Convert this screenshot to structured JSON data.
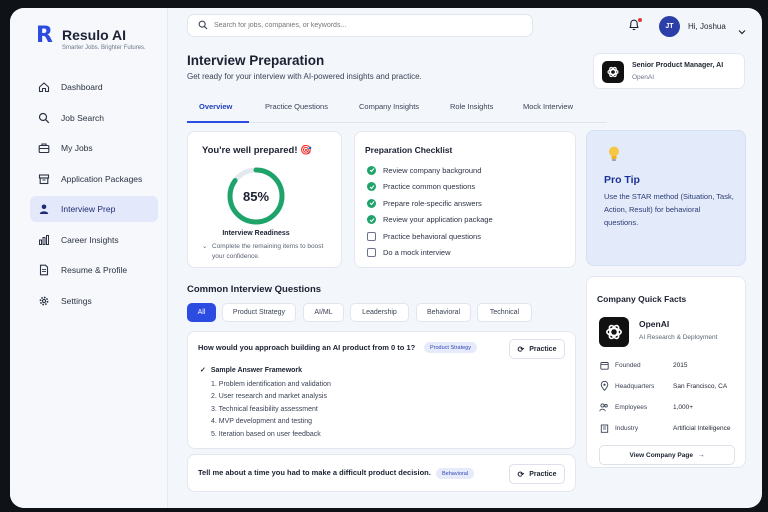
{
  "brand": {
    "name": "Resulo AI",
    "tagline": "Smarter Jobs. Brighter Futures.",
    "accent": "#2c4be0"
  },
  "sidebar": {
    "items": [
      {
        "label": "Dashboard",
        "icon": "home-icon"
      },
      {
        "label": "Job Search",
        "icon": "search-icon"
      },
      {
        "label": "My Jobs",
        "icon": "briefcase-icon"
      },
      {
        "label": "Application Packages",
        "icon": "package-icon"
      },
      {
        "label": "Interview Prep",
        "icon": "user-icon",
        "active": true
      },
      {
        "label": "Career Insights",
        "icon": "bar-chart-icon"
      },
      {
        "label": "Resume & Profile",
        "icon": "document-icon"
      },
      {
        "label": "Settings",
        "icon": "gear-icon"
      }
    ]
  },
  "header": {
    "search_placeholder": "Search for jobs, companies, or keywords...",
    "avatar_initials": "JT",
    "user_greeting": "Hi, Joshua"
  },
  "page": {
    "title": "Interview Preparation",
    "subtitle": "Get ready for your interview with AI-powered insights and practice.",
    "role": {
      "title": "Senior Product Manager, AI",
      "company": "OpenAI"
    }
  },
  "tabs": [
    "Overview",
    "Practice Questions",
    "Company Insights",
    "Role Insights",
    "Mock Interview"
  ],
  "readiness": {
    "heading": "You're well prepared! 🎯",
    "percent_label": "85%",
    "percent": 85,
    "label": "Interview Readiness",
    "note": "Complete the remaining items to boost your confidence.",
    "ring_color": "#1ea36a"
  },
  "checklist": {
    "title": "Preparation Checklist",
    "items": [
      {
        "label": "Review company background",
        "done": true
      },
      {
        "label": "Practice common questions",
        "done": true
      },
      {
        "label": "Prepare role-specific answers",
        "done": true
      },
      {
        "label": "Review your application package",
        "done": true
      },
      {
        "label": "Practice behavioral questions",
        "done": false
      },
      {
        "label": "Do a mock interview",
        "done": false
      }
    ]
  },
  "tip": {
    "title": "Pro Tip",
    "body": "Use the STAR method (Situation, Task, Action, Result) for behavioral questions."
  },
  "questions": {
    "title": "Common Interview Questions",
    "filters": [
      "All",
      "Product Strategy",
      "AI/ML",
      "Leadership",
      "Behavioral",
      "Technical"
    ],
    "practice_label": "Practice",
    "items": [
      {
        "text": "How would you approach building an AI product from 0 to 1?",
        "tag": "Product Strategy",
        "answer_heading": "Sample Answer Framework",
        "steps": [
          "1. Problem identification and validation",
          "2. User research and market analysis",
          "3. Technical feasibility assessment",
          "4. MVP development and testing",
          "5. Iteration based on user feedback"
        ]
      },
      {
        "text": "Tell me about a time you had to make a difficult product decision.",
        "tag": "Behavioral"
      }
    ]
  },
  "company_facts": {
    "title": "Company Quick Facts",
    "name": "OpenAI",
    "description": "AI Research & Deployment",
    "facts": [
      {
        "label": "Founded",
        "value": "2015",
        "icon": "calendar-icon"
      },
      {
        "label": "Headquarters",
        "value": "San Francisco, CA",
        "icon": "location-pin-icon"
      },
      {
        "label": "Employees",
        "value": "1,000+",
        "icon": "people-icon"
      },
      {
        "label": "Industry",
        "value": "Artificial Intelligence",
        "icon": "building-icon"
      }
    ],
    "button_label": "View Company Page"
  }
}
